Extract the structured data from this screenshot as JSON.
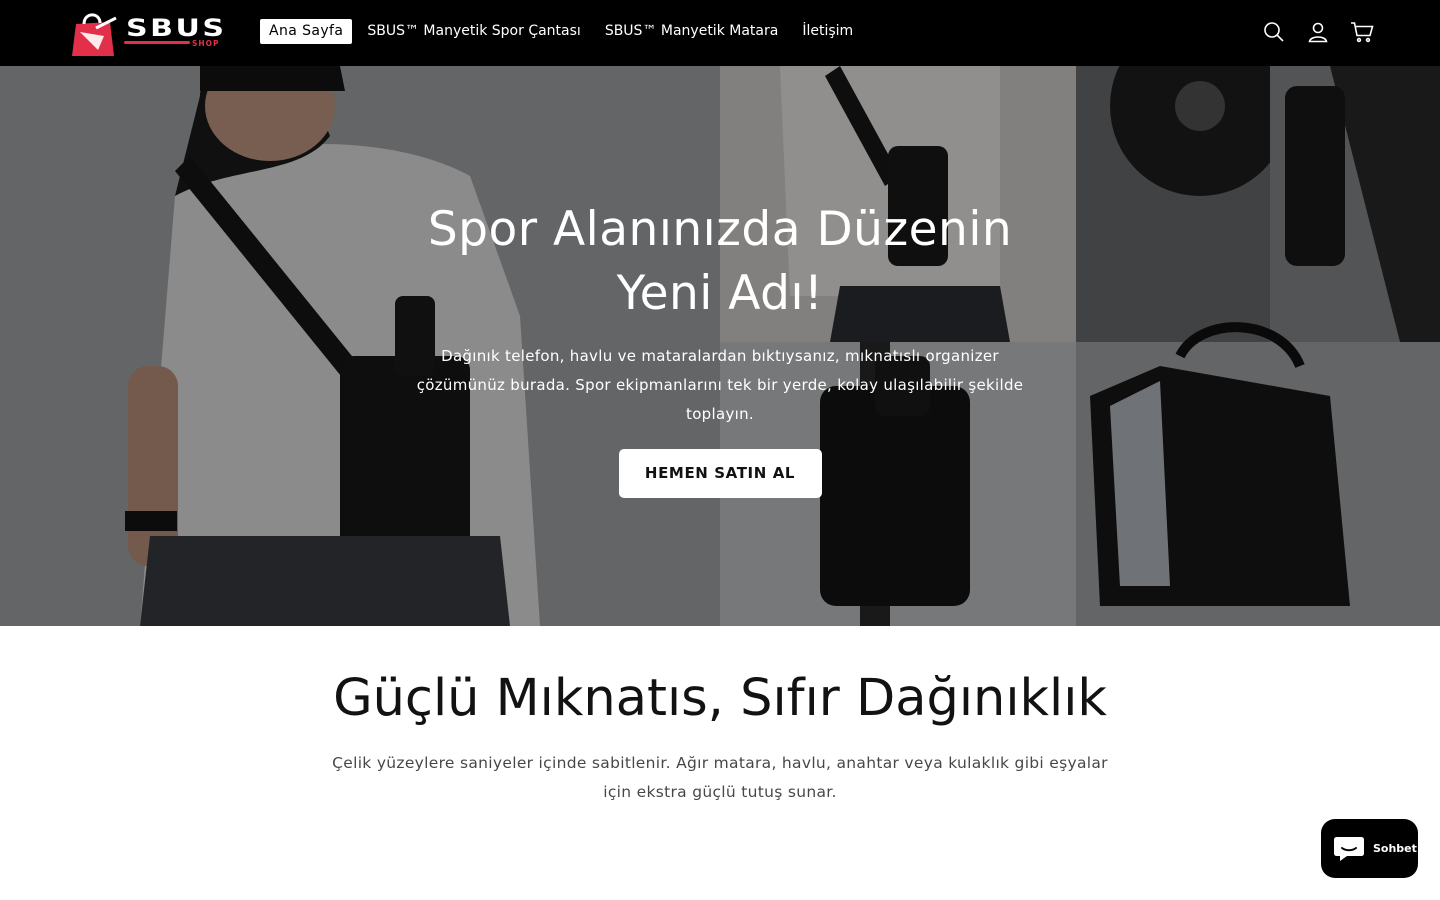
{
  "brand": {
    "logo_text": "SBUS",
    "logo_subtext": "SHOP"
  },
  "nav": {
    "items": [
      {
        "label": "Ana Sayfa",
        "active": true
      },
      {
        "label": "SBUS™ Manyetik Spor Çantası",
        "active": false
      },
      {
        "label": "SBUS™ Manyetik Matara",
        "active": false
      },
      {
        "label": "İletişim",
        "active": false
      }
    ]
  },
  "header_icons": [
    "search-icon",
    "account-icon",
    "cart-icon"
  ],
  "hero": {
    "title_line1": "Spor Alanınızda Düzenin",
    "title_line2": "Yeni Adı!",
    "text": "Dağınık telefon, havlu ve mataralardan bıktıysanız, mıknatıslı organizer çözümünüz burada. Spor ekipmanlarını tek bir yerde, kolay ulaşılabilir şekilde toplayın.",
    "button_label": "HEMEN SATIN AL"
  },
  "feature": {
    "title": "Güçlü Mıknatıs, Sıfır Dağınıklık",
    "text": "Çelik yüzeylere saniyeler içinde sabitlenir. Ağır matara, havlu, anahtar veya kulaklık gibi eşyalar için ekstra güçlü tutuş sunar."
  },
  "chat": {
    "label": "Sohbet"
  },
  "colors": {
    "header_bg": "#000000",
    "brand_accent": "#e2304a",
    "button_bg": "#ffffff",
    "text_dark": "#121212"
  }
}
